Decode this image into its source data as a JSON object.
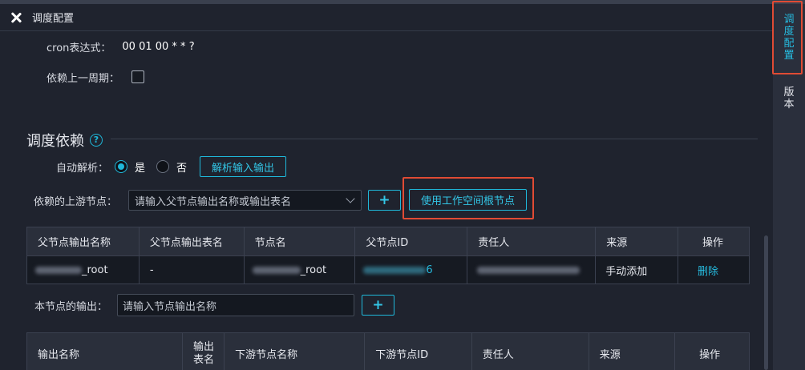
{
  "header": {
    "title": "调度配置"
  },
  "side_tabs": [
    {
      "label": [
        "调",
        "度",
        "配",
        "置"
      ],
      "color": "#26bce0"
    },
    {
      "label": [
        "版",
        "本"
      ],
      "color": "#e6e8ee"
    }
  ],
  "cron": {
    "label": "cron表达式：",
    "value": "00 01 00 * * ?"
  },
  "depend_prev": {
    "label": "依赖上一周期："
  },
  "section": {
    "title": "调度依赖",
    "help_icon": "?"
  },
  "auto_parse": {
    "label": "自动解析：",
    "yes": "是",
    "no": "否",
    "selected": "是",
    "button": "解析输入输出"
  },
  "upstream": {
    "label": "依赖的上游节点：",
    "placeholder": "请输入父节点输出名称或输出表名",
    "add_button": "+",
    "root_button": "使用工作空间根节点"
  },
  "parent_table": {
    "columns": [
      "父节点输出名称",
      "父节点输出表名",
      "节点名",
      "父节点ID",
      "责任人",
      "来源",
      "操作"
    ],
    "rows": [
      {
        "output_name_suffix": "_root",
        "table_name": "-",
        "node_name_suffix": "_root",
        "node_id_suffix": "6",
        "source": "手动添加",
        "action": "删除"
      }
    ]
  },
  "output": {
    "label": "本节点的输出：",
    "placeholder": "请输入节点输出名称",
    "add_button": "+"
  },
  "child_table": {
    "columns": [
      "输出名称",
      "输出表名",
      "下游节点名称",
      "下游节点ID",
      "责任人",
      "来源",
      "操作"
    ]
  },
  "colors": {
    "accent": "#1fb8da",
    "highlight": "#e04b34",
    "background": "#1f232e"
  }
}
